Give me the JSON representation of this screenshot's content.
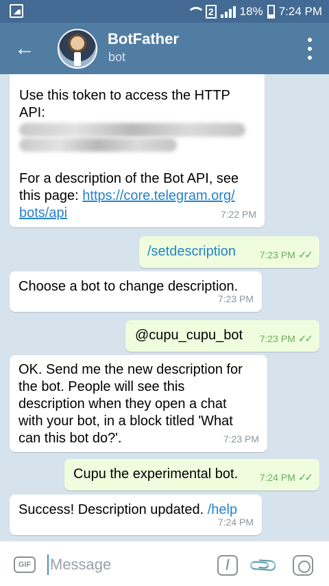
{
  "status_bar": {
    "sim": "2",
    "battery": "18%",
    "time": "7:24 PM"
  },
  "header": {
    "title": "BotFather",
    "subtitle": "bot"
  },
  "messages": [
    {
      "line1": "Use this token to access the HTTP",
      "line2": "API:",
      "line3": "For a description of the Bot API, see",
      "line4_prefix": "this page: ",
      "link_part1": "https://core.telegram.org/",
      "link_part2": "bots/api",
      "time": "7:22 PM"
    },
    {
      "text": "/setdescription",
      "time": "7:23 PM"
    },
    {
      "text": "Choose a bot to change description.",
      "time": "7:23 PM"
    },
    {
      "text": "@cupu_cupu_bot",
      "time": "7:23 PM"
    },
    {
      "text": "OK. Send me the new description for\nthe bot. People will see this\ndescription when they open a chat\nwith your bot, in a block titled 'What\ncan this bot do?'.",
      "time": "7:23 PM"
    },
    {
      "text": "Cupu the experimental bot.",
      "time": "7:24 PM"
    },
    {
      "text_prefix": "Success! Description updated. ",
      "command": "/help",
      "time": "7:24 PM"
    }
  ],
  "input": {
    "placeholder": "Message",
    "gif_label": "GIF",
    "command_label": "/"
  }
}
